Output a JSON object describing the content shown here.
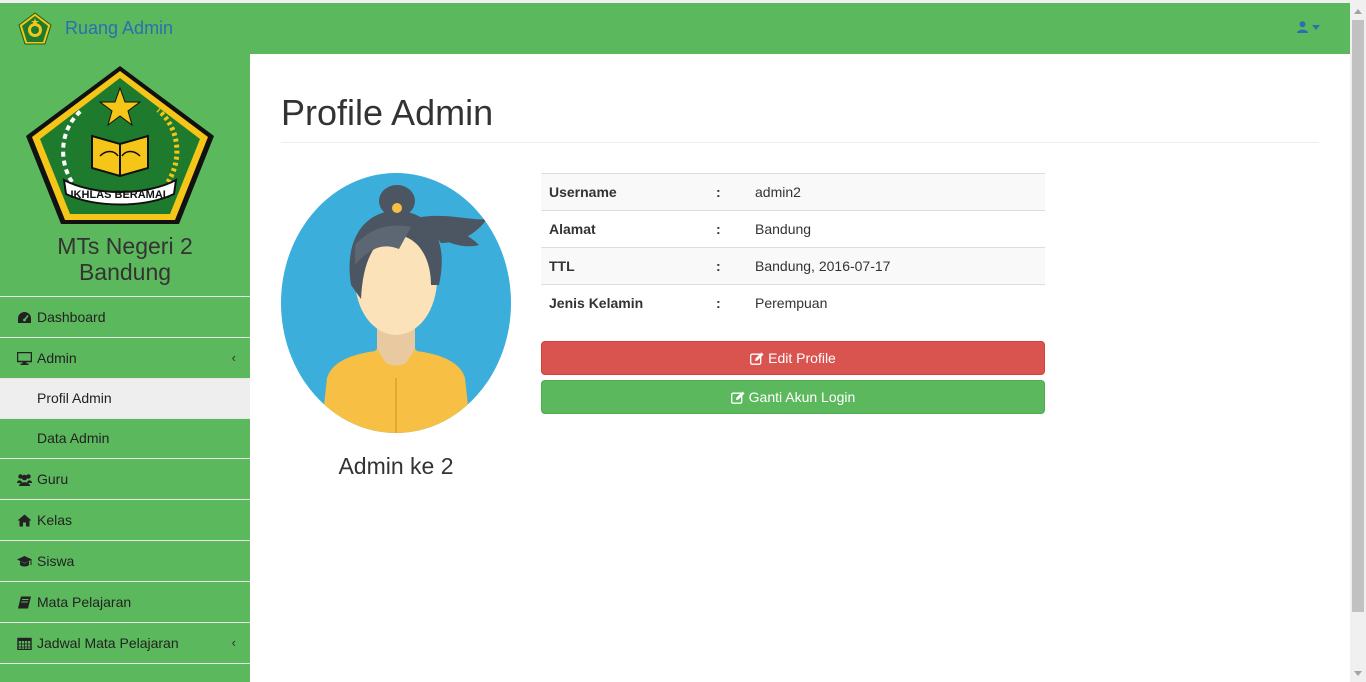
{
  "navbar": {
    "brand": "Ruang Admin",
    "user_icon": "user-icon"
  },
  "sidebar": {
    "logo_text": "IKHLAS BERAMAL",
    "school_name": "MTs Negeri 2 Bandung",
    "items": [
      {
        "label": "Dashboard",
        "icon": "dashboard-icon"
      },
      {
        "label": "Admin",
        "icon": "desktop-icon",
        "chevron": "‹"
      },
      {
        "label": "Profil Admin",
        "active": true
      },
      {
        "label": "Data Admin"
      },
      {
        "label": "Guru",
        "icon": "users-icon"
      },
      {
        "label": "Kelas",
        "icon": "home-icon"
      },
      {
        "label": "Siswa",
        "icon": "graduation-cap-icon"
      },
      {
        "label": "Mata Pelajaran",
        "icon": "book-icon"
      },
      {
        "label": "Jadwal Mata Pelajaran",
        "icon": "calendar-icon",
        "chevron": "‹"
      }
    ]
  },
  "main": {
    "page_title": "Profile Admin",
    "admin_name": "Admin ke 2",
    "details": [
      {
        "key": "Username",
        "sep": ":",
        "value": "admin2"
      },
      {
        "key": "Alamat",
        "sep": ":",
        "value": "Bandung"
      },
      {
        "key": "TTL",
        "sep": ":",
        "value": "Bandung, 2016-07-17"
      },
      {
        "key": "Jenis Kelamin",
        "sep": ":",
        "value": "Perempuan"
      }
    ],
    "buttons": {
      "edit_profile": "Edit Profile",
      "ganti_akun": "Ganti Akun Login"
    }
  },
  "colors": {
    "primary_green": "#5cb85c",
    "danger_red": "#d9534f",
    "link_blue": "#2c6fb0"
  }
}
